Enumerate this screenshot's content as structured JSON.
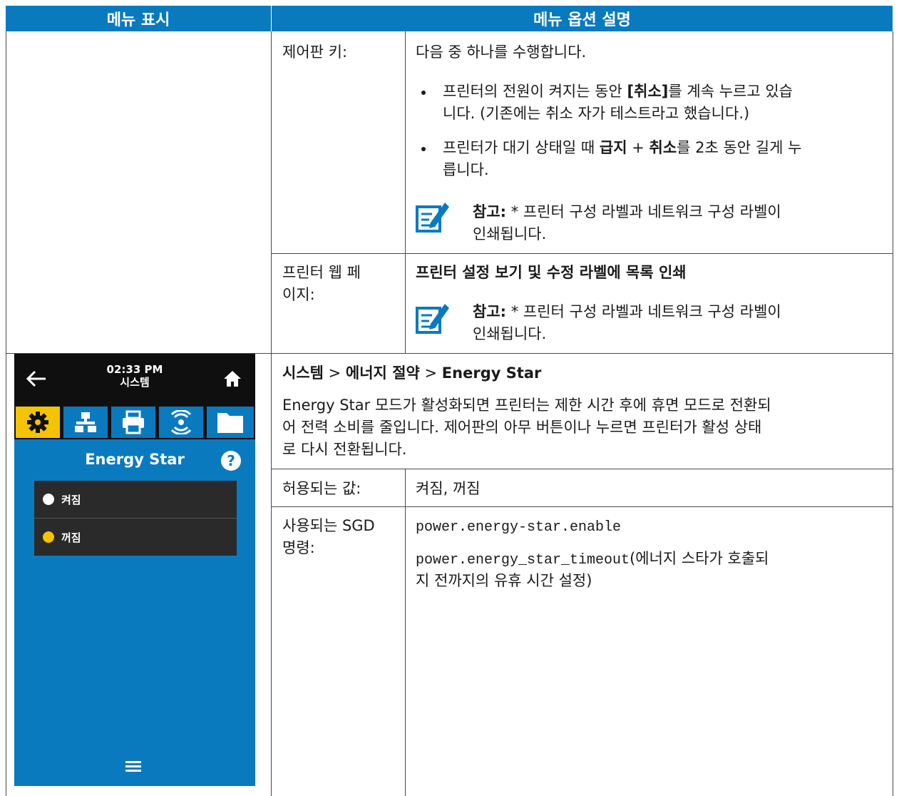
{
  "header": {
    "col1": "메뉴 표시",
    "col2": "메뉴 옵션 설명"
  },
  "rows": {
    "control_panel": {
      "label": "제어판 키:",
      "intro": "다음 중 하나를 수행합니다.",
      "bullet1_line1_pre": "프린터의 전원이 켜지는 동안 ",
      "bullet1_line1_bold": "[취소]",
      "bullet1_line1_post": "를 계속 누르고 있습",
      "bullet1_line2": "니다. (기존에는 취소 자가 테스트라고 했습니다.)",
      "bullet2_line1_pre": "프린터가 대기 상태일 때 ",
      "bullet2_bold1": "급지",
      "bullet2_mid": " + ",
      "bullet2_bold2": "취소",
      "bullet2_post": "를 2초 동안 길게 누",
      "bullet2_line2": "릅니다.",
      "note_label": "참고:",
      "note_line1": " * 프린터 구성 라벨과 네트워크 구성 라벨이",
      "note_line2": "인쇄됩니다."
    },
    "web_page": {
      "label_line1": "프린터 웹 페",
      "label_line2": "이지:",
      "heading": "프린터 설정 보기 및 수정 라벨에 목록 인쇄",
      "note_label": "참고:",
      "note_line1": " * 프린터 구성 라벨과 네트워크 구성 라벨이",
      "note_line2": "인쇄됩니다."
    },
    "energy": {
      "path_bold1": "시스템",
      "path_sep1": " > ",
      "path_bold2": "에너지 절약",
      "path_sep2": " > ",
      "path_bold3": "Energy Star",
      "desc_line1": "Energy Star 모드가 활성화되면 프린터는 제한 시간 후에 휴면 모드로 전환되",
      "desc_line2": "어 전력 소비를 줄입니다. 제어판의 아무 버튼이나 누르면 프린터가 활성 상태",
      "desc_line3": "로 다시 전환됩니다.",
      "accepted_label": "허용되는 값:",
      "accepted_value": "켜짐, 꺼짐",
      "sgd_label_line1": "사용되는 SGD",
      "sgd_label_line2": "명령:",
      "sgd_cmd1": "power.energy-star.enable",
      "sgd_cmd2": "power.energy_star_timeout",
      "sgd_cmd2_note_line1": "(에너지 스타가 호출되",
      "sgd_cmd2_note_line2": "지 전까지의 유휴 시간 설정)"
    }
  },
  "device": {
    "time": "02:33 PM",
    "title": "시스템",
    "screen_title": "Energy Star",
    "option_on": "켜짐",
    "option_off": "꺼짐",
    "colors": {
      "screen_blue": "#0a7abf",
      "tab_active": "#f5c400",
      "selected_radio": "#f5c400"
    },
    "icons": [
      "back-arrow-icon",
      "home-icon",
      "gear-icon",
      "network-icon",
      "printer-icon",
      "wireless-icon",
      "folder-icon",
      "help-icon",
      "menu-icon"
    ]
  }
}
